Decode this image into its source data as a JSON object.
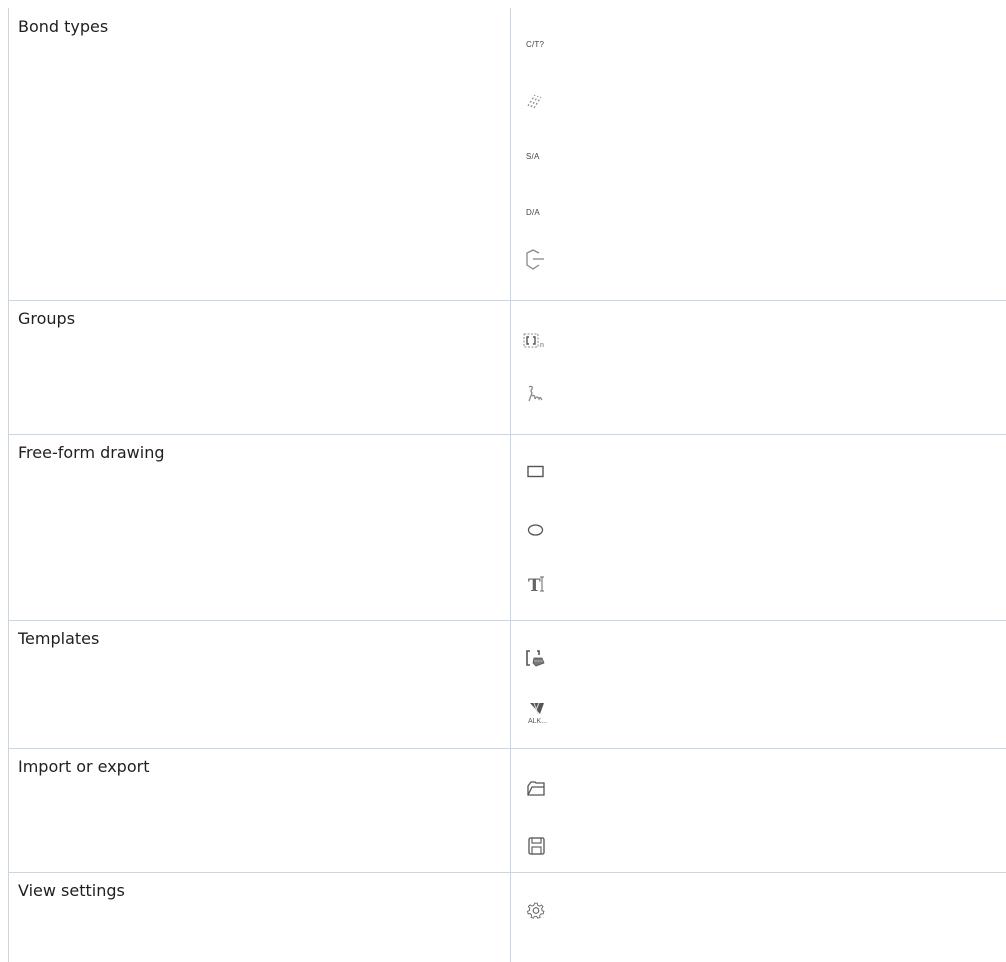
{
  "rows": [
    {
      "label": "Bond types",
      "icons": [
        {
          "name": "cis-trans-unknown-bond-icon",
          "text": "C/T?"
        },
        {
          "name": "any-bond-icon"
        },
        {
          "name": "single-aromatic-bond-icon",
          "text": "S/A"
        },
        {
          "name": "double-aromatic-bond-icon",
          "text": "D/A"
        },
        {
          "name": "ring-bond-icon"
        }
      ]
    },
    {
      "label": "Groups",
      "icons": [
        {
          "name": "bracket-group-icon"
        },
        {
          "name": "r-group-icon"
        }
      ]
    },
    {
      "label": "Free-form drawing",
      "icons": [
        {
          "name": "rectangle-icon"
        },
        {
          "name": "ellipse-icon"
        },
        {
          "name": "text-tool-icon"
        }
      ]
    },
    {
      "label": "Templates",
      "icons": [
        {
          "name": "template-library-icon"
        },
        {
          "name": "alkane-template-icon",
          "text": "ALK..."
        }
      ]
    },
    {
      "label": "Import or export",
      "icons": [
        {
          "name": "open-folder-icon"
        },
        {
          "name": "save-icon"
        }
      ]
    },
    {
      "label": "View settings",
      "icons": [
        {
          "name": "gear-icon"
        }
      ]
    }
  ],
  "colors": {
    "border": "#c8d6e4",
    "text": "#1f1f1f",
    "icon": "#888888"
  }
}
